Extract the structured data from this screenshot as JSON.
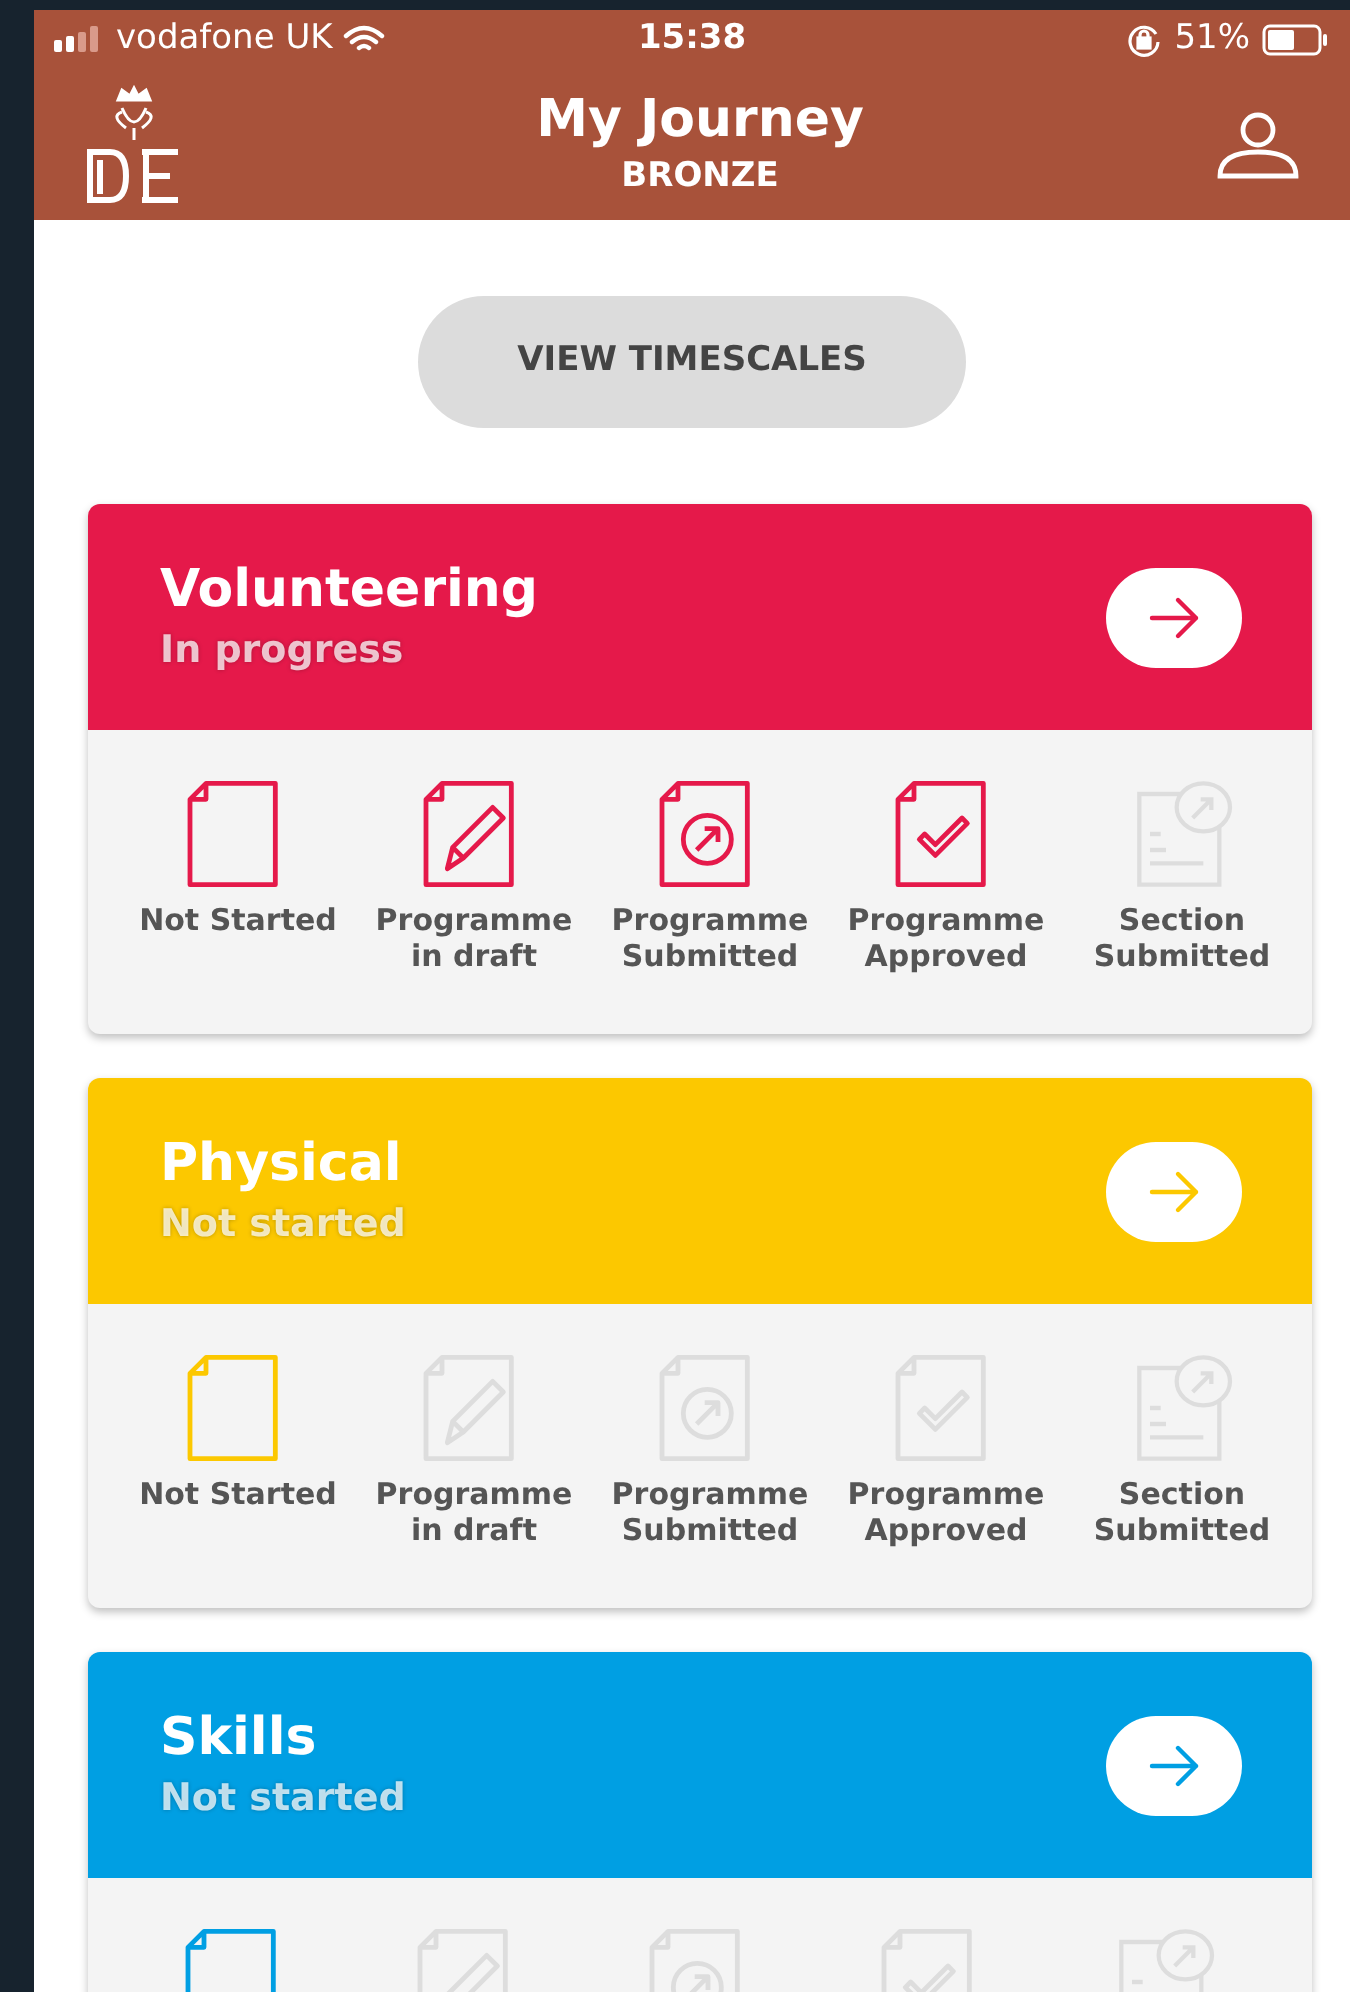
{
  "status_bar": {
    "carrier": "vodafone UK",
    "time": "15:38",
    "battery": "51%"
  },
  "header": {
    "title": "My Journey",
    "subtitle": "BRONZE"
  },
  "timescales_button": "VIEW TIMESCALES",
  "sections": [
    {
      "title": "Volunteering",
      "status": "In progress",
      "color": "#e5194a",
      "stages": [
        {
          "kind": "blank",
          "label": "Not Started",
          "done": true
        },
        {
          "kind": "draft",
          "label": "Programme in draft",
          "done": true
        },
        {
          "kind": "submitted",
          "label": "Programme Submitted",
          "done": true
        },
        {
          "kind": "approved",
          "label": "Programme Approved",
          "done": true
        },
        {
          "kind": "section",
          "label": "Section Submitted",
          "done": false
        }
      ]
    },
    {
      "title": "Physical",
      "status": "Not started",
      "color": "#fcc800",
      "stages": [
        {
          "kind": "blank",
          "label": "Not Started",
          "done": true
        },
        {
          "kind": "draft",
          "label": "Programme in draft",
          "done": false
        },
        {
          "kind": "submitted",
          "label": "Programme Submitted",
          "done": false
        },
        {
          "kind": "approved",
          "label": "Programme Approved",
          "done": false
        },
        {
          "kind": "section",
          "label": "Section Submitted",
          "done": false
        }
      ]
    },
    {
      "title": "Skills",
      "status": "Not started",
      "color": "#009fe3",
      "stages": [
        {
          "kind": "blank",
          "done": true
        },
        {
          "kind": "draft",
          "done": false
        },
        {
          "kind": "submitted",
          "done": false
        },
        {
          "kind": "approved",
          "done": false
        },
        {
          "kind": "section",
          "done": false
        }
      ]
    }
  ]
}
